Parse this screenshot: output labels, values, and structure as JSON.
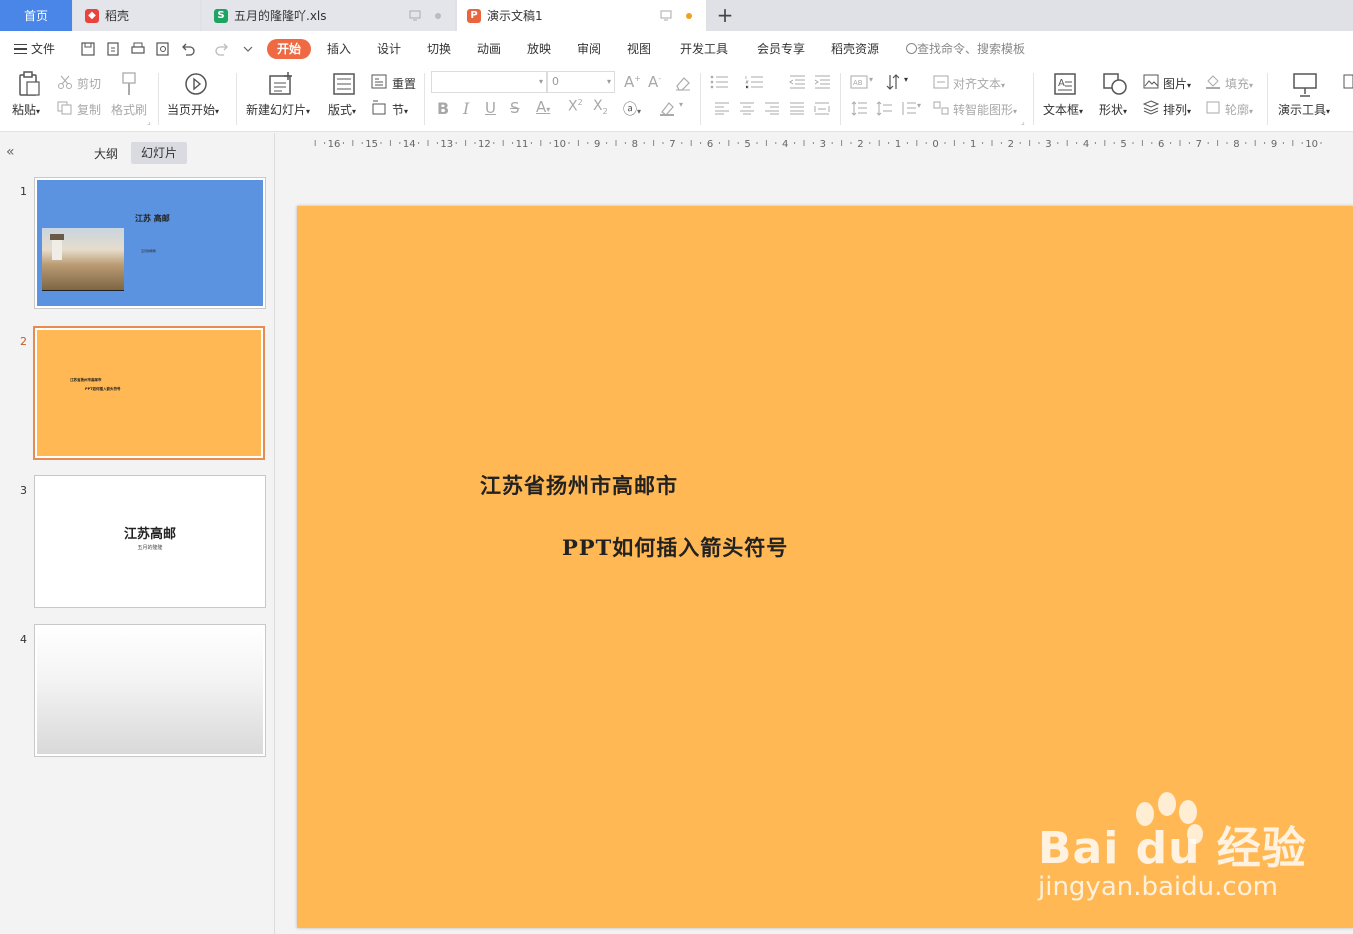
{
  "tabs": [
    {
      "label": "首页"
    },
    {
      "label": "稻壳"
    },
    {
      "label": "五月的隆隆吖.xls"
    },
    {
      "label": "演示文稿1"
    }
  ],
  "menu": {
    "file": "文件",
    "items": [
      "开始",
      "插入",
      "设计",
      "切换",
      "动画",
      "放映",
      "审阅",
      "视图",
      "开发工具",
      "会员专享",
      "稻壳资源"
    ],
    "search_placeholder": "查找命令、搜索模板"
  },
  "ribbon": {
    "paste": "粘贴",
    "cut": "剪切",
    "copy": "复制",
    "format_painter": "格式刷",
    "start_from_first": "当页开始",
    "new_slide": "新建幻灯片",
    "layout": "版式",
    "reset": "重置",
    "section": "节",
    "font_size_value": "0",
    "align_text": "对齐文本",
    "smartart": "转智能图形",
    "textbox": "文本框",
    "shape": "形状",
    "picture": "图片",
    "arrange": "排列",
    "fill": "填充",
    "outline": "轮廓",
    "presentation_tools": "演示工具"
  },
  "panel": {
    "outline_tab": "大纲",
    "slides_tab": "幻灯片",
    "slides": [
      {
        "number": "1",
        "title": "江苏 高邮",
        "subtitle": "五月的隆隆"
      },
      {
        "number": "2",
        "line1": "江苏省扬州市高邮市",
        "line2": "PPT如何插入箭头符号"
      },
      {
        "number": "3",
        "title": "江苏高邮",
        "subtitle": "五月的隆隆"
      },
      {
        "number": "4"
      }
    ]
  },
  "ruler_labels": [
    "16",
    "15",
    "14",
    "13",
    "12",
    "11",
    "10",
    "9",
    "8",
    "7",
    "6",
    "5",
    "4",
    "3",
    "2",
    "1",
    "0",
    "1",
    "2",
    "3",
    "4",
    "5",
    "6",
    "7",
    "8",
    "9",
    "10"
  ],
  "slide": {
    "title": "江苏省扬州市高邮市",
    "subtitle": "PPT如何插入箭头符号",
    "background": "#ffb853"
  },
  "watermark": {
    "brand": "Bai du 经验",
    "url": "jingyan.baidu.com"
  },
  "colors": {
    "accent": "#ef6a42",
    "home_tab": "#4a86e8",
    "slide1_bg": "#5b93e0",
    "slide_orange": "#ffb853"
  }
}
